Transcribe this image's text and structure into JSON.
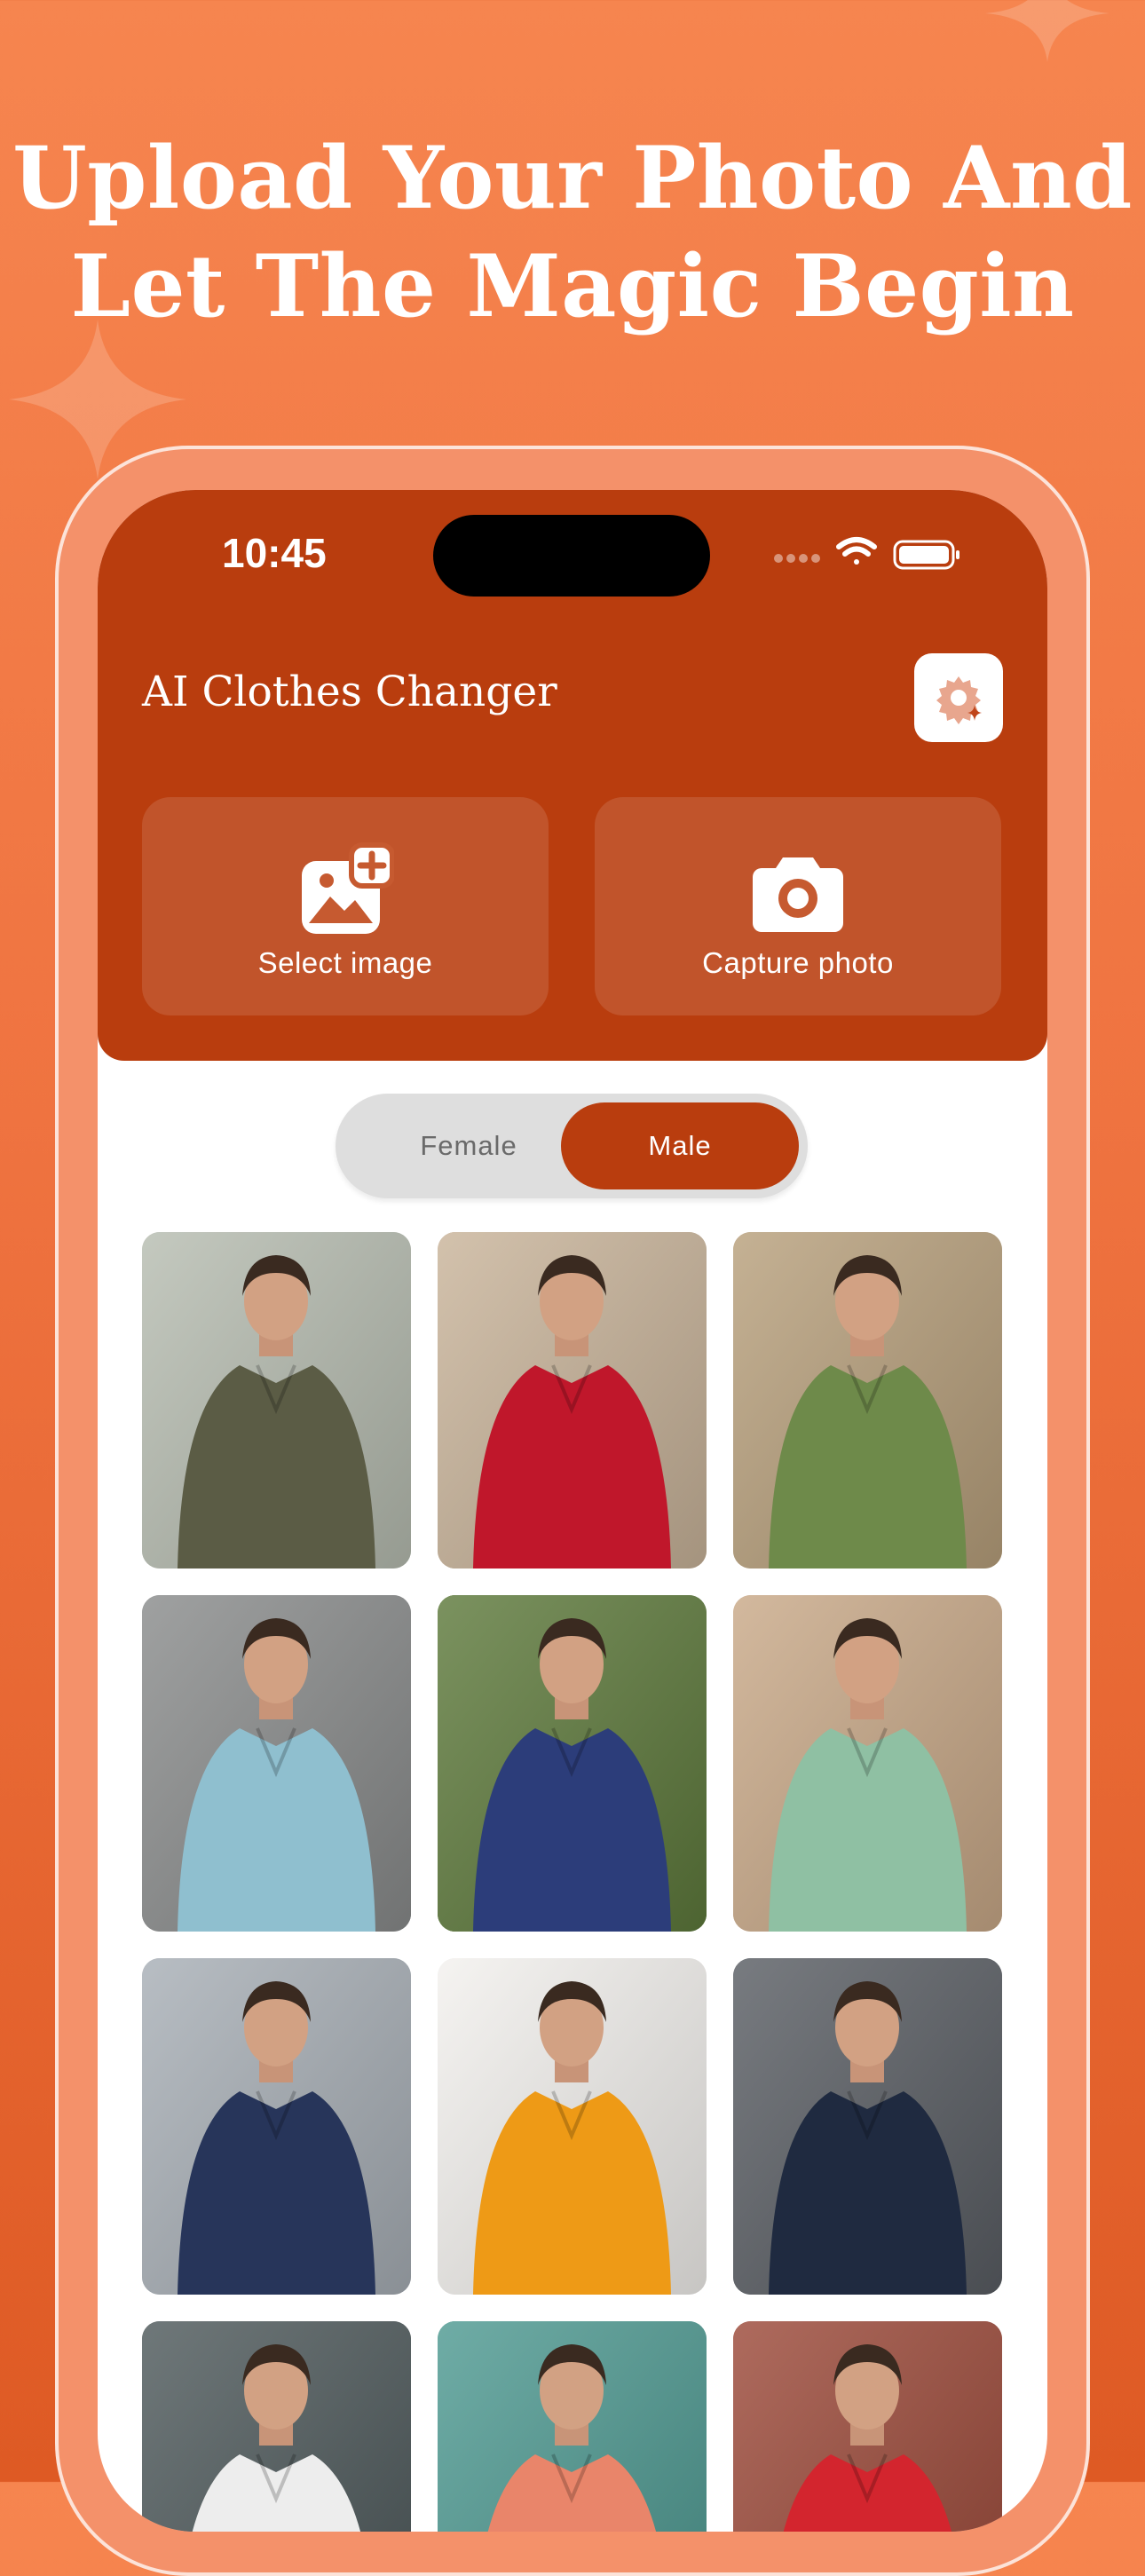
{
  "headline": {
    "line1": "Upload Your Photo And",
    "line2": "Let The Magic Begin"
  },
  "status_bar": {
    "time": "10:45",
    "icons": [
      "signal-dots-icon",
      "wifi-icon",
      "battery-icon"
    ]
  },
  "app": {
    "title": "AI Clothes Changer",
    "settings_icon": "settings-sparkle-icon"
  },
  "actions": [
    {
      "label": "Select image",
      "icon": "add-image-icon"
    },
    {
      "label": "Capture photo",
      "icon": "camera-icon"
    }
  ],
  "gender_toggle": {
    "options": [
      "Female",
      "Male"
    ],
    "selected": "Male"
  },
  "colors": {
    "background": "#F07A45",
    "header": "#B93D0E",
    "accent": "#B93D0E",
    "white": "#FFFFFF"
  },
  "outfits": [
    {
      "name": "olive-jacket",
      "bg": "#B7BDB1",
      "top": "#5B5C45"
    },
    {
      "name": "red-tshirt",
      "bg": "#C9B49A",
      "top": "#C0172B"
    },
    {
      "name": "green-shirt",
      "bg": "#B8A07C",
      "top": "#6E8A4A"
    },
    {
      "name": "blue-sherwani",
      "bg": "#8A8C8C",
      "top": "#8FBFCF"
    },
    {
      "name": "navy-suit",
      "bg": "#5E7A3C",
      "top": "#2C3D7A"
    },
    {
      "name": "green-kurta",
      "bg": "#C9A988",
      "top": "#8FC0A3"
    },
    {
      "name": "navy-coat",
      "bg": "#A8AFB6",
      "top": "#27355A"
    },
    {
      "name": "orange-hoodie",
      "bg": "#F3F1EE",
      "top": "#EE9A16"
    },
    {
      "name": "double-breasted-suit",
      "bg": "#5A5E64",
      "top": "#1F2A40"
    },
    {
      "name": "white-tee-gym",
      "bg": "#4F5A5C",
      "top": "#EDEDED"
    },
    {
      "name": "coral-hoodie",
      "bg": "#4F9A92",
      "top": "#E9856A"
    },
    {
      "name": "red-sweater",
      "bg": "#9C4A3A",
      "top": "#D3252E"
    }
  ]
}
